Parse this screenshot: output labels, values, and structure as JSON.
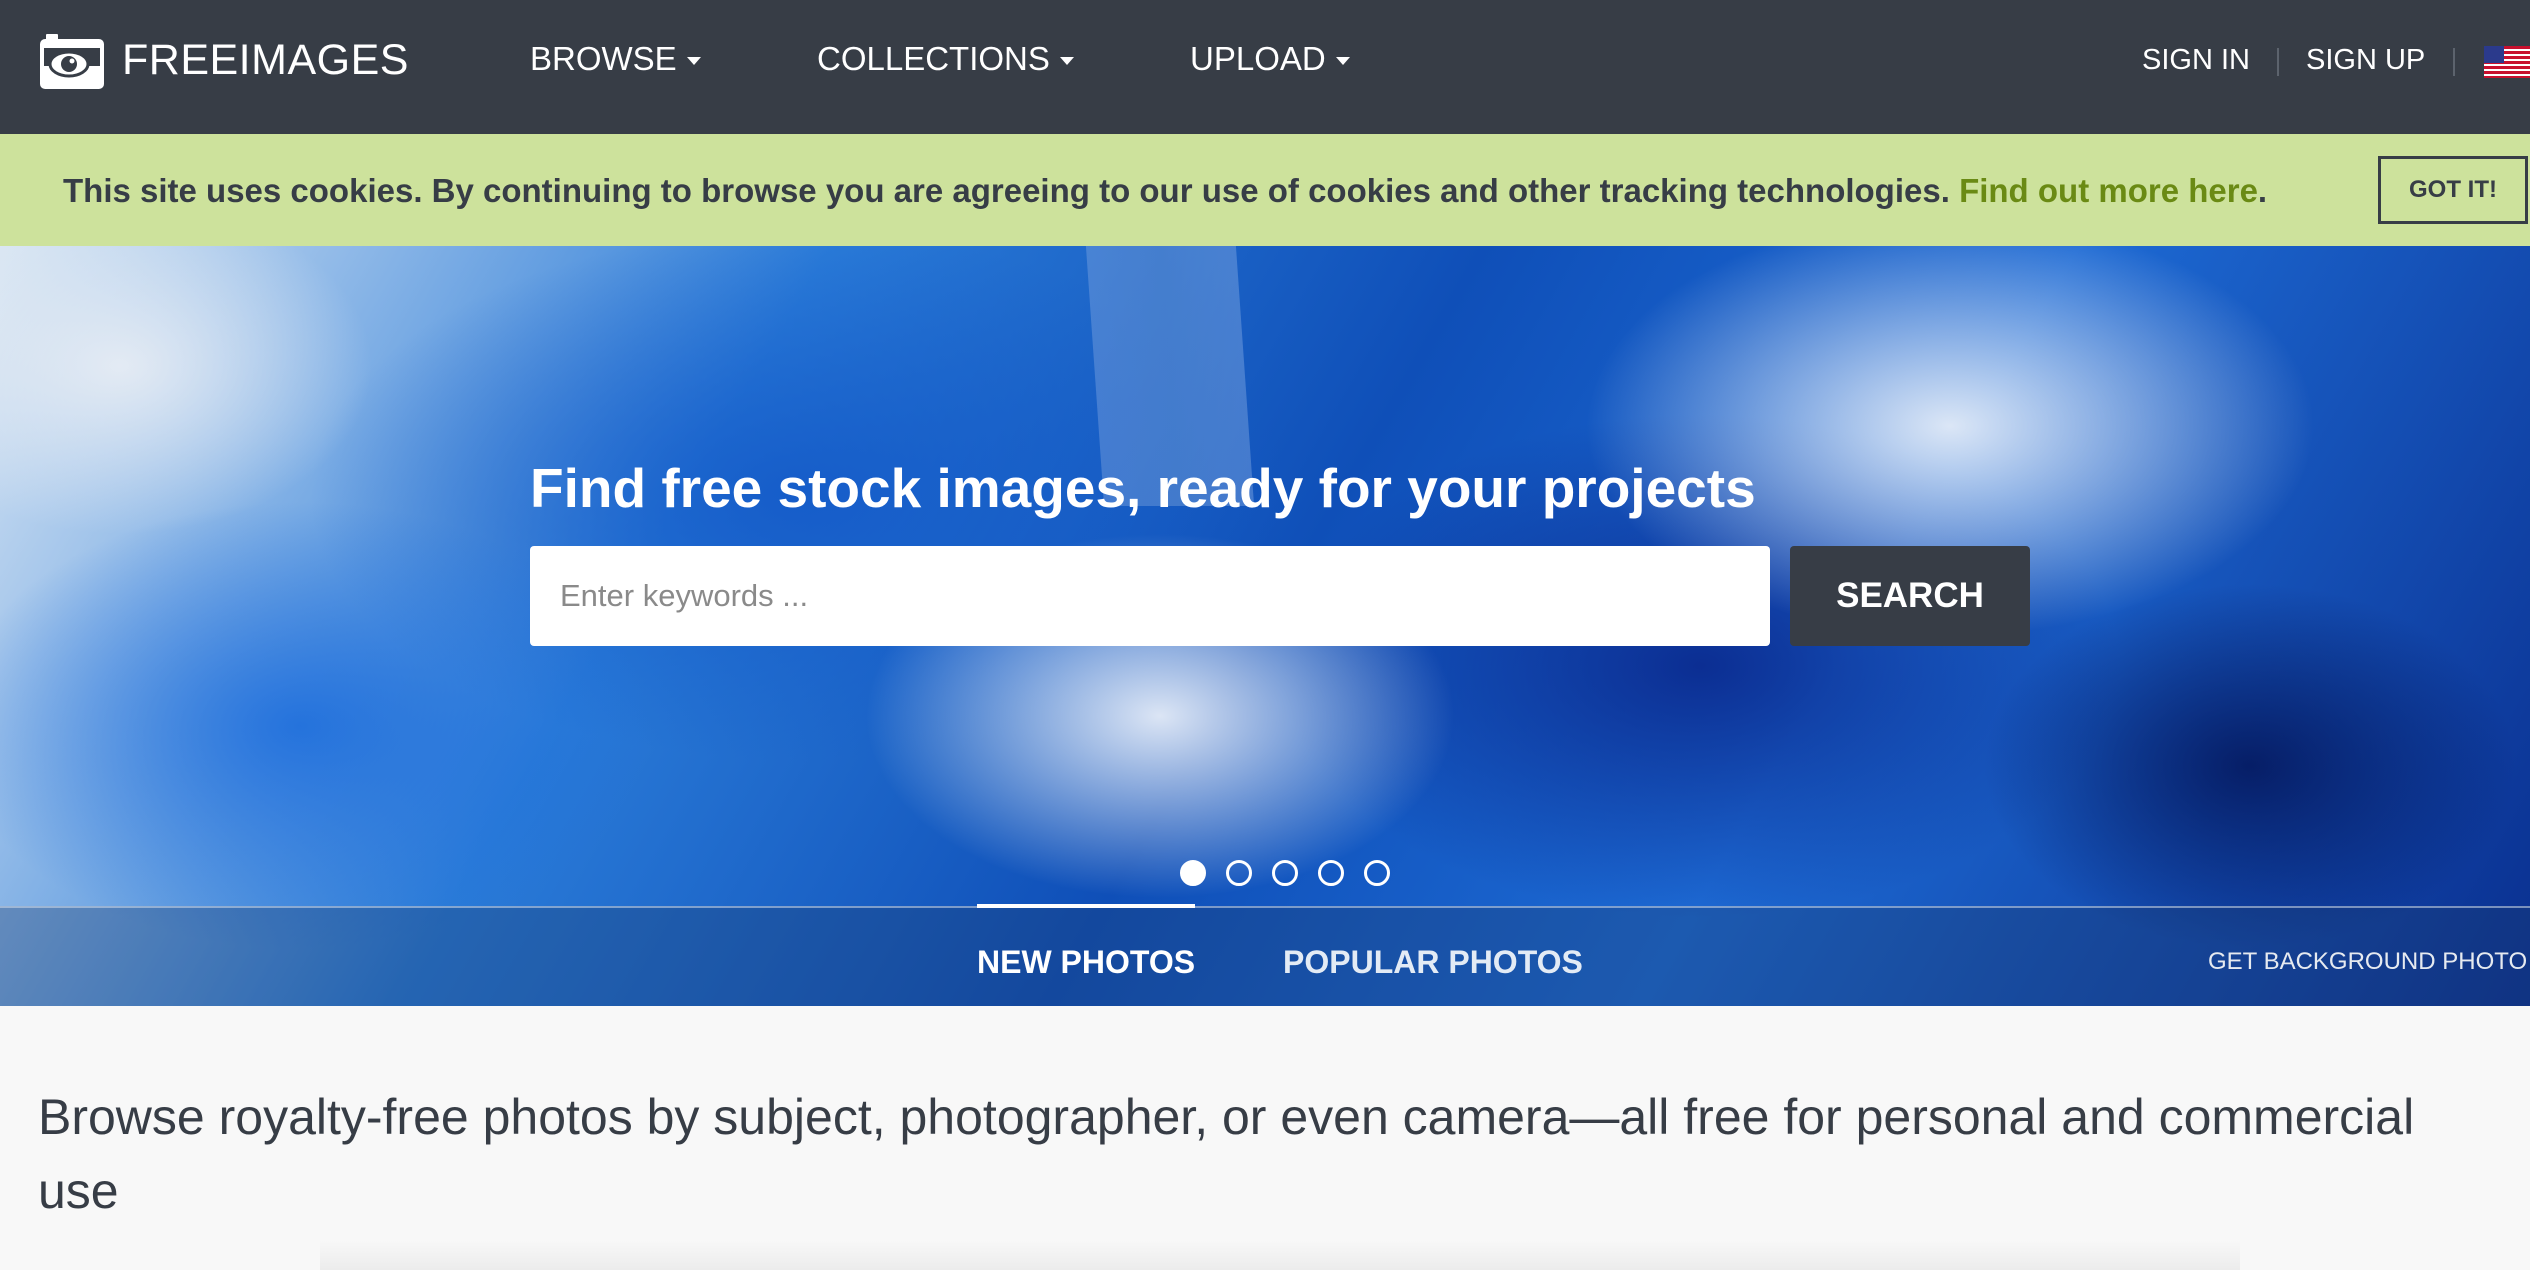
{
  "brand": {
    "name": "FREEIMAGES"
  },
  "nav": {
    "browse": "BROWSE",
    "collections": "COLLECTIONS",
    "upload": "UPLOAD",
    "sign_in": "SIGN IN",
    "sign_up": "SIGN UP"
  },
  "cookie": {
    "text": "This site uses cookies. By continuing to browse you are agreeing to our use of cookies and other tracking technologies. ",
    "link": "Find out more here",
    "period": ".",
    "button": "GOT IT!"
  },
  "hero": {
    "title": "Find free stock images, ready for your projects",
    "search_placeholder": "Enter keywords ...",
    "search_button": "SEARCH",
    "carousel_total": 5,
    "carousel_active": 1
  },
  "tabs": {
    "new_photos": "NEW PHOTOS",
    "popular_photos": "POPULAR PHOTOS",
    "active": "new_photos",
    "get_background": "GET BACKGROUND PHOTO"
  },
  "main": {
    "tagline": "Browse royalty-free photos by subject, photographer, or even camera—all free for personal and commercial use"
  },
  "colors": {
    "navbar": "#373d46",
    "cookie_bar": "#cde29c",
    "link_green": "#6a8a14"
  },
  "icons": [
    "camera-logo-icon",
    "caret-down-icon",
    "us-flag-icon"
  ]
}
